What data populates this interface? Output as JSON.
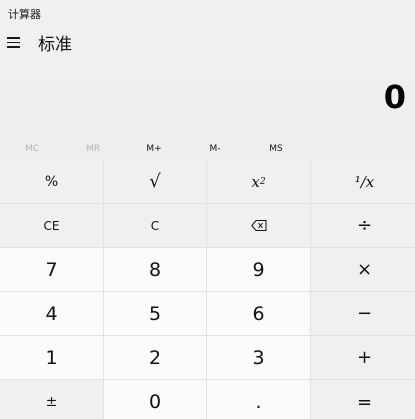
{
  "window": {
    "title": "计算器"
  },
  "header": {
    "mode": "标准",
    "menu_icon": "hamburger-menu-icon"
  },
  "display": {
    "value": "0"
  },
  "memory": [
    {
      "label": "MC",
      "enabled": false
    },
    {
      "label": "MR",
      "enabled": false
    },
    {
      "label": "M+",
      "enabled": true
    },
    {
      "label": "M-",
      "enabled": true
    },
    {
      "label": "MS",
      "enabled": true
    }
  ],
  "keys": {
    "percent": "%",
    "sqrt": "√",
    "square_base": "x",
    "square_exp": "2",
    "reciprocal": "¹∕x",
    "ce": "CE",
    "c": "C",
    "backspace": "⌫",
    "divide": "÷",
    "d7": "7",
    "d8": "8",
    "d9": "9",
    "multiply": "×",
    "d4": "4",
    "d5": "5",
    "d6": "6",
    "minus": "−",
    "d1": "1",
    "d2": "2",
    "d3": "3",
    "plus": "+",
    "negate": "±",
    "d0": "0",
    "decimal": ".",
    "equals": "="
  },
  "colors": {
    "function_key_bg": "#f0f0f0",
    "number_key_bg": "#fbfbfb",
    "disabled_text": "#b4b4b4"
  }
}
